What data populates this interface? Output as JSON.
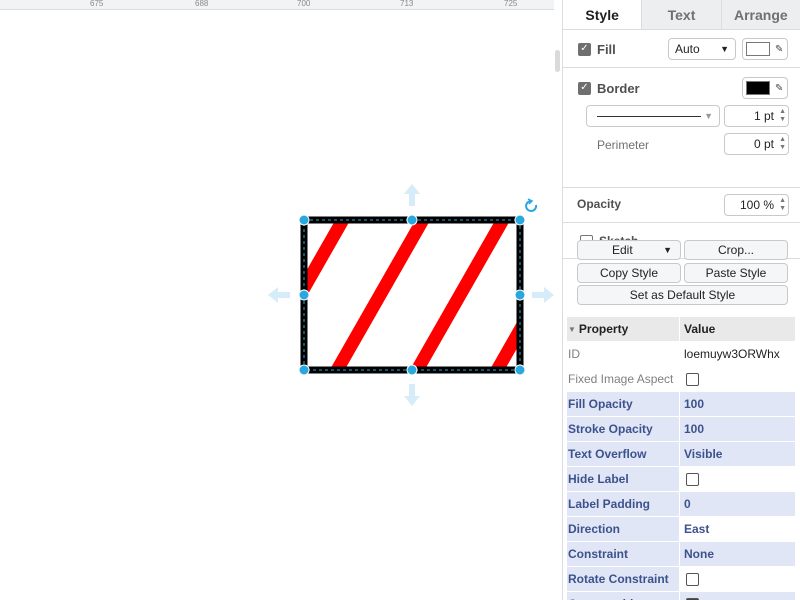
{
  "ruler": {
    "ticks": [
      "675",
      "688",
      "700",
      "713",
      "725"
    ]
  },
  "tabs": [
    {
      "label": "Style",
      "active": true
    },
    {
      "label": "Text",
      "active": false
    },
    {
      "label": "Arrange",
      "active": false
    }
  ],
  "style": {
    "fill": {
      "label": "Fill",
      "checked": true,
      "mode": "Auto",
      "color": "#ffffff"
    },
    "border": {
      "label": "Border",
      "checked": true,
      "color": "#000000",
      "width": "1 pt"
    },
    "perimeter": {
      "label": "Perimeter",
      "value": "0 pt"
    },
    "opacity": {
      "label": "Opacity",
      "value": "100 %"
    },
    "sketch": {
      "label": "Sketch",
      "checked": false
    }
  },
  "buttons": {
    "edit": "Edit",
    "crop": "Crop...",
    "copy_style": "Copy Style",
    "paste_style": "Paste Style",
    "set_default": "Set as Default Style"
  },
  "properties": {
    "header": {
      "property": "Property",
      "value": "Value"
    },
    "rows": [
      {
        "name": "ID",
        "value": "loemuyw3ORWhx",
        "kind": "plain",
        "checkbox": false
      },
      {
        "name": "Fixed Image Aspect",
        "value": "",
        "kind": "plain",
        "checkbox": true,
        "checked": false
      },
      {
        "name": "Fill Opacity",
        "value": "100",
        "kind": "blue",
        "checkbox": false
      },
      {
        "name": "Stroke Opacity",
        "value": "100",
        "kind": "plain",
        "checkbox": false
      },
      {
        "name": "Text Overflow",
        "value": "Visible",
        "kind": "blue",
        "checkbox": false
      },
      {
        "name": "Hide Label",
        "value": "",
        "kind": "plain",
        "checkbox": true,
        "checked": false
      },
      {
        "name": "Label Padding",
        "value": "0",
        "kind": "blue",
        "checkbox": false
      },
      {
        "name": "Direction",
        "value": "East",
        "kind": "plain",
        "checkbox": false
      },
      {
        "name": "Constraint",
        "value": "None",
        "kind": "blue",
        "checkbox": false
      },
      {
        "name": "Rotate Constraint",
        "value": "",
        "kind": "plain",
        "checkbox": true,
        "checked": false
      },
      {
        "name": "Connectable",
        "value": "",
        "kind": "blue",
        "checkbox": true,
        "checked": true
      }
    ]
  },
  "colors": {
    "accent": "#29a8e0",
    "stripe": "#ff0000",
    "shape_border": "#000000",
    "selected_row": "#e0e6f5"
  }
}
